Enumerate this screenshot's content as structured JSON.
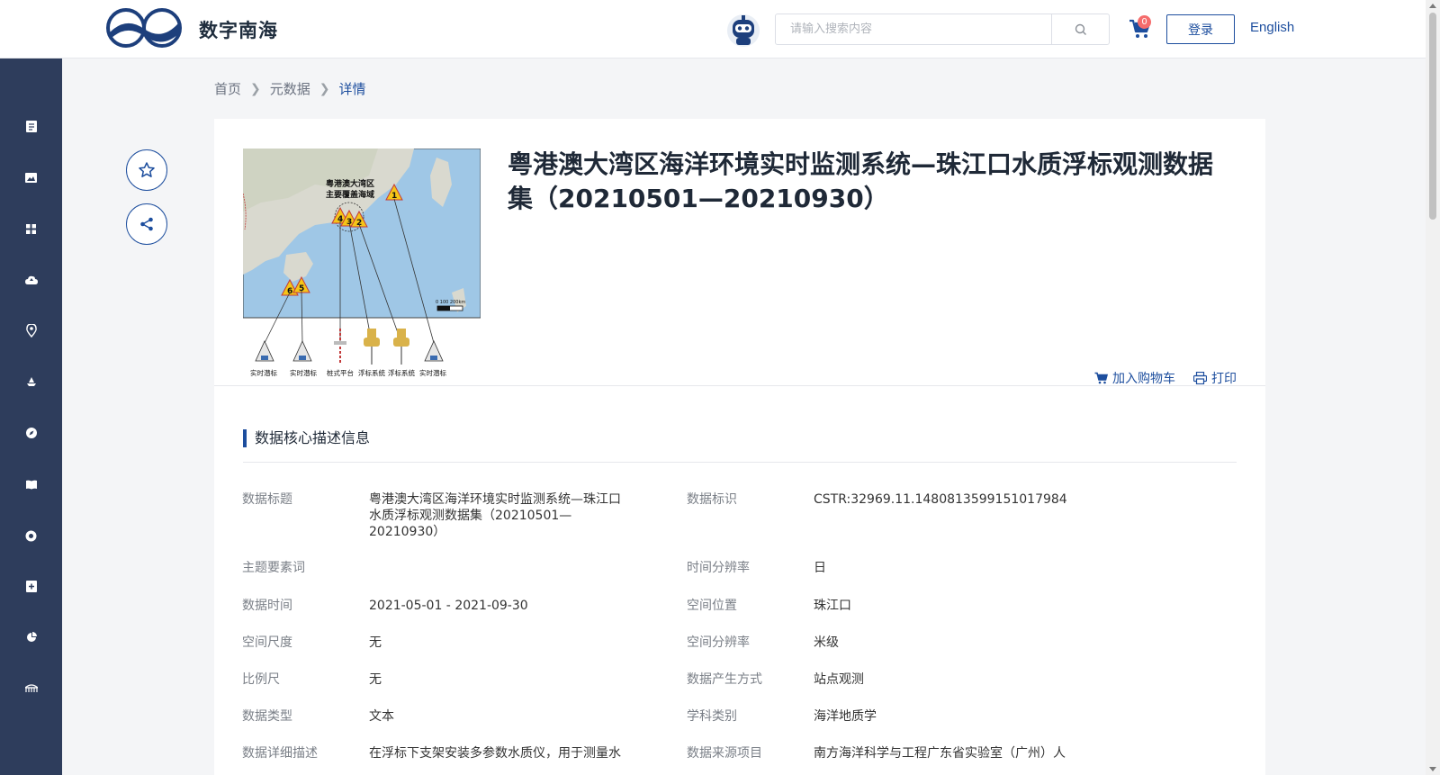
{
  "header": {
    "brand": "数字南海",
    "search_placeholder": "请输入搜索内容",
    "cart_count": "0",
    "login_label": "登录",
    "language_label": "English"
  },
  "sidebar": {
    "icons": [
      "document-icon",
      "image-icon",
      "grid-icon",
      "cloud-upload-icon",
      "location-icon",
      "ship-icon",
      "compass-icon",
      "book-icon",
      "lifebuoy-icon",
      "add-file-icon",
      "pie-chart-icon",
      "bridge-icon"
    ]
  },
  "breadcrumb": {
    "home": "首页",
    "metadata": "元数据",
    "current": "详情"
  },
  "dataset": {
    "title": "粤港澳大湾区海洋环境实时监测系统—珠江口水质浮标观测数据集（20210501—20210930）",
    "add_to_cart": "加入购物车",
    "print": "打印"
  },
  "map_figure": {
    "region_label_line1": "粤港澳大湾区",
    "region_label_line2": "主要覆盖海域",
    "markers": [
      "1",
      "2",
      "3",
      "4",
      "5",
      "6"
    ],
    "scale": "0  100  200km",
    "stations": [
      "实时潜标",
      "实时潜标",
      "桩式平台",
      "浮标系统",
      "浮标系统",
      "实时潜标"
    ]
  },
  "section": {
    "title": "数据核心描述信息"
  },
  "fields": {
    "data_title_label": "数据标题",
    "data_title_line1": "粤港澳大湾区海洋环境实时监测系统—珠江口",
    "data_title_line2": "水质浮标观测数据集（20210501—",
    "data_title_line3": "20210930）",
    "data_id_label": "数据标识",
    "data_id_value": "CSTR:32969.11.1480813599151017984",
    "keywords_label": "主题要素词",
    "keywords_value": "",
    "time_res_label": "时间分辨率",
    "time_res_value": "日",
    "data_time_label": "数据时间",
    "data_time_value": "2021-05-01 - 2021-09-30",
    "spatial_loc_label": "空间位置",
    "spatial_loc_value": "珠江口",
    "spatial_scale_label": "空间尺度",
    "spatial_scale_value": "无",
    "spatial_res_label": "空间分辨率",
    "spatial_res_value": "米级",
    "ratio_label": "比例尺",
    "ratio_value": "无",
    "gen_method_label": "数据产生方式",
    "gen_method_value": "站点观测",
    "data_type_label": "数据类型",
    "data_type_value": "文本",
    "discipline_label": "学科类别",
    "discipline_value": "海洋地质学",
    "detail_desc_label": "数据详细描述",
    "detail_desc_value": "在浮标下支架安装多参数水质仪，用于测量水",
    "source_project_label": "数据来源项目",
    "source_project_value": "南方海洋科学与工程广东省实验室（广州）人"
  }
}
